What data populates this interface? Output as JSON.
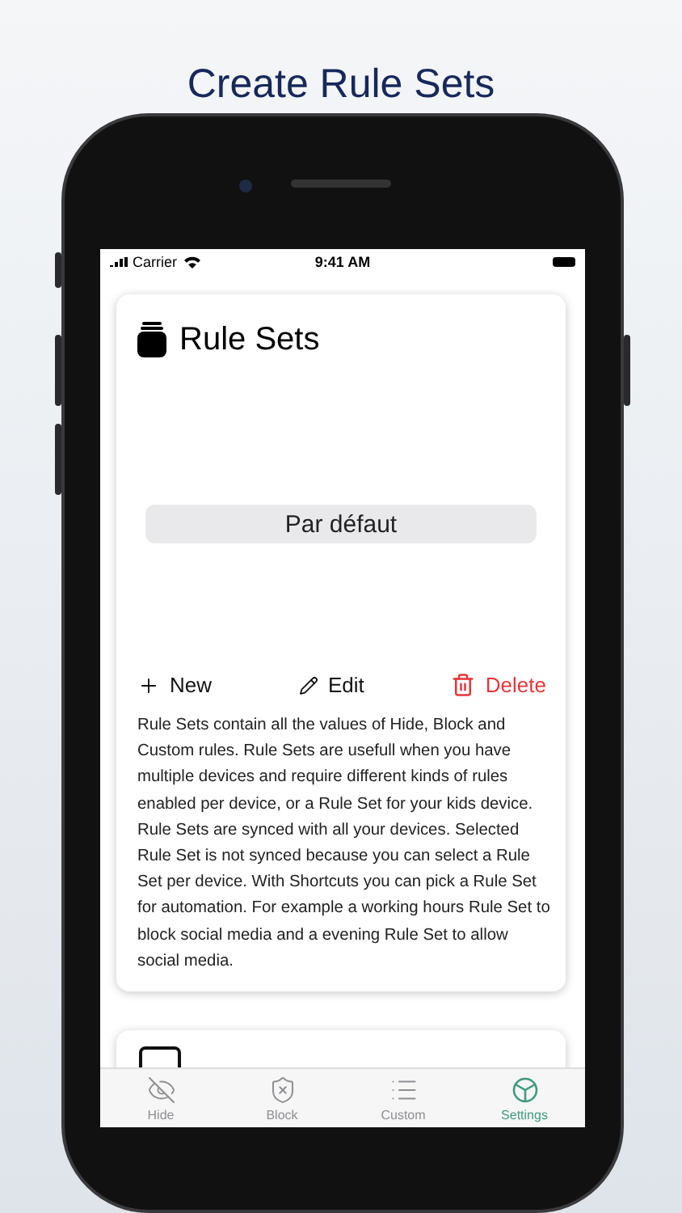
{
  "headline": "Create Rule Sets",
  "status_bar": {
    "carrier": "Carrier",
    "time": "9:41 AM"
  },
  "card": {
    "title": "Rule Sets",
    "picker": {
      "value": "Par défaut"
    },
    "actions": [
      {
        "kind": "new",
        "label": "New"
      },
      {
        "kind": "edit",
        "label": "Edit"
      },
      {
        "kind": "delete",
        "label": "Delete"
      }
    ],
    "description": "Rule Sets contain all the values of Hide, Block and Custom rules. Rule Sets are usefull when you have multiple devices and require different kinds of rules enabled per device, or a Rule Set for your kids device. Rule Sets are synced with all your devices. Selected Rule Set is not synced because you can select a Rule Set per device. With Shortcuts you can pick a Rule Set for automation. For example a working hours Rule Set to block social media and a evening Rule Set to allow social media."
  },
  "tabs": [
    {
      "kind": "hide",
      "label": "Hide",
      "selected": false
    },
    {
      "kind": "block",
      "label": "Block",
      "selected": false
    },
    {
      "kind": "custom",
      "label": "Custom",
      "selected": false
    },
    {
      "kind": "settings",
      "label": "Settings",
      "selected": true
    }
  ]
}
